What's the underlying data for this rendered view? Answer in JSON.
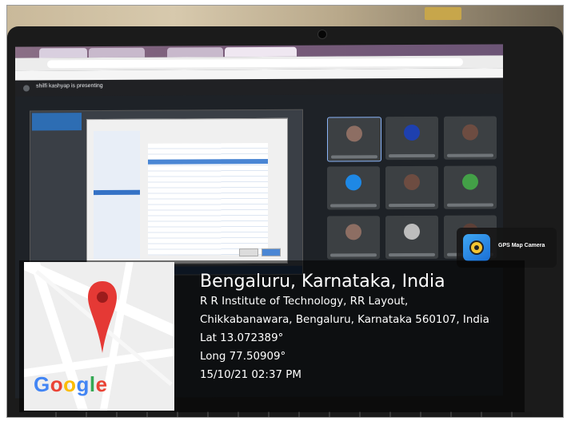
{
  "screen": {
    "presenting_text": "shilfi kashyap is presenting"
  },
  "gps_badge": {
    "label": "GPS Map Camera"
  },
  "map": {
    "logo_text": [
      "G",
      "o",
      "o",
      "g",
      "l",
      "e"
    ]
  },
  "location": {
    "title": "Bengaluru, Karnataka, India",
    "address_line1": "R R Institute of Technology, RR Layout,",
    "address_line2": "Chikkabanawara, Bengaluru, Karnataka 560107, India",
    "lat": "Lat 13.072389°",
    "long": "Long 77.50909°",
    "datetime": "15/10/21 02:37 PM"
  },
  "colors": {
    "pin": "#e53935",
    "google_blue": "#4285f4",
    "google_red": "#ea4335",
    "google_yellow": "#fbbc05",
    "google_green": "#34a853",
    "active_tile_border": "#8ab4f8"
  },
  "participants": [
    {
      "color": "#8d6e63"
    },
    {
      "color": "#1e40af"
    },
    {
      "color": "#6d4c41"
    },
    {
      "color": "#1e88e5"
    },
    {
      "color": "#6d4c41"
    },
    {
      "color": "#43a047"
    },
    {
      "color": "#8d6e63"
    },
    {
      "color": "#bdbdbd"
    },
    {
      "color": "#5d4037"
    }
  ]
}
